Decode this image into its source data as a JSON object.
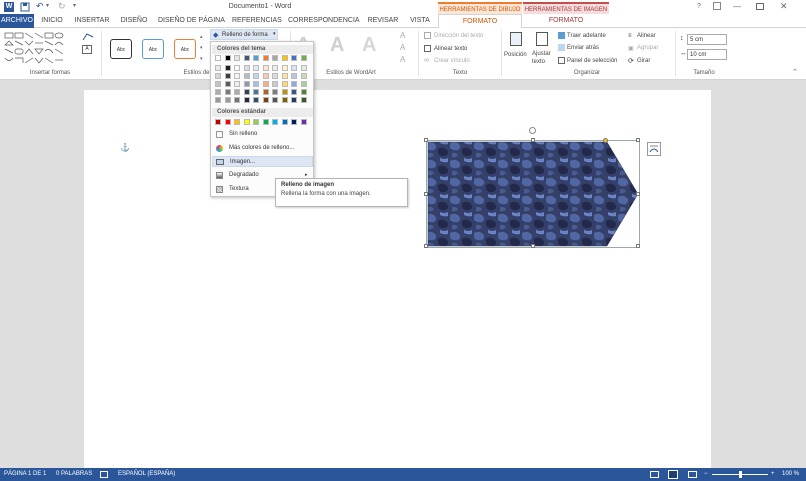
{
  "window": {
    "title": "Documento1 - Word",
    "context_drawing": "HERRAMIENTAS DE DIBUJO",
    "context_image": "HERRAMIENTAS DE IMAGEN",
    "help": "?"
  },
  "tabs": {
    "archivo": "ARCHIVO",
    "inicio": "INICIO",
    "insertar": "INSERTAR",
    "diseno": "DISEÑO",
    "diseno_pagina": "DISEÑO DE PÁGINA",
    "referencias": "REFERENCIAS",
    "correspondencia": "CORRESPONDENCIA",
    "revisar": "REVISAR",
    "vista": "VISTA",
    "formato_dibujo": "FORMATO",
    "formato_imagen": "FORMATO"
  },
  "ribbon": {
    "groups": {
      "insertar_formas": "Insertar formas",
      "estilos_forma": "Estilos de forma",
      "estilos_wordart": "Estilos de WordArt",
      "texto": "Texto",
      "organizar": "Organizar",
      "tamano": "Tamaño"
    },
    "style_sample": "Abc",
    "relleno_forma": "Relleno de forma",
    "direccion_texto": "Dirección del texto",
    "alinear_texto": "Alinear texto",
    "crear_vinculo": "Crear vínculo",
    "posicion": "Posición",
    "ajustar_texto": "Ajustar texto",
    "traer_adelante": "Traer adelante",
    "enviar_atras": "Enviar atrás",
    "panel_seleccion": "Panel de selección",
    "alinear": "Alinear",
    "agrupar": "Agrupar",
    "girar": "Girar",
    "alto": "5 cm",
    "ancho": "10 cm"
  },
  "fill_menu": {
    "theme_header": "Colores del tema",
    "standard_header": "Colores estándar",
    "sin_relleno": "Sin relleno",
    "mas_colores": "Más colores de relleno...",
    "imagen": "Imagen...",
    "degradado": "Degradado",
    "textura": "Textura",
    "theme_colors": [
      "#ffffff",
      "#000000",
      "#e7e6e6",
      "#44546a",
      "#5b9bd5",
      "#ed7d31",
      "#a5a5a5",
      "#ffc000",
      "#4472c4",
      "#70ad47"
    ],
    "standard_colors": [
      "#c00000",
      "#ff0000",
      "#ffc000",
      "#ffff00",
      "#92d050",
      "#00b050",
      "#00b0f0",
      "#0070c0",
      "#002060",
      "#7030a0"
    ]
  },
  "tooltip": {
    "title": "Relleno de imagen",
    "body": "Rellena la forma con una imagen."
  },
  "status": {
    "page": "PÁGINA 1 DE 1",
    "words": "0 PALABRAS",
    "language": "ESPAÑOL (ESPAÑA)",
    "zoom": "100 %"
  },
  "colors": {
    "status_bar": "#2b579a",
    "accent": "#2b579a",
    "context_drawing": "#d35400",
    "context_image": "#a4373a",
    "shape_fill": "#2f3f6b"
  }
}
